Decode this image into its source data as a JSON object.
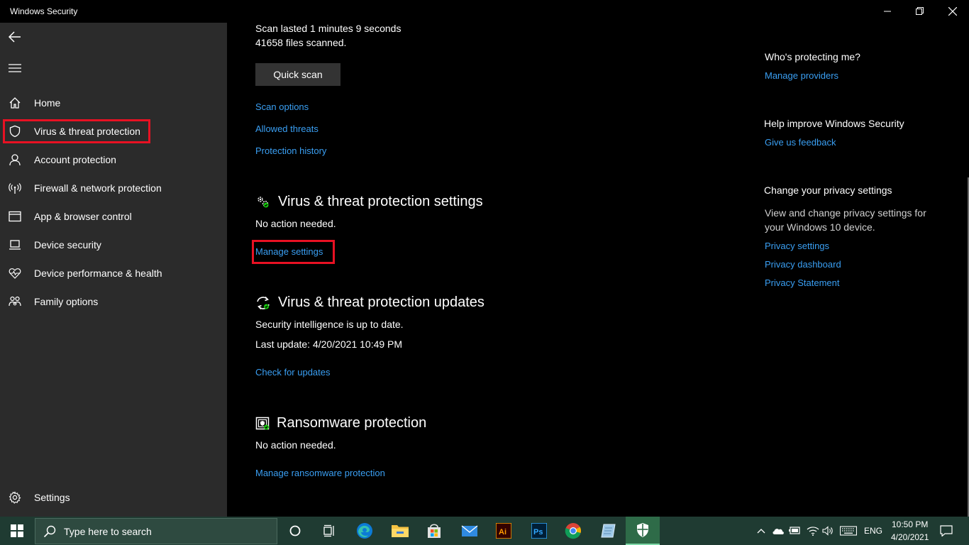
{
  "window": {
    "title": "Windows Security"
  },
  "sidebar": {
    "items": [
      {
        "label": "Home",
        "icon": "home-icon"
      },
      {
        "label": "Virus & threat protection",
        "icon": "shield-icon"
      },
      {
        "label": "Account protection",
        "icon": "person-icon"
      },
      {
        "label": "Firewall & network protection",
        "icon": "wireless-icon"
      },
      {
        "label": "App & browser control",
        "icon": "browser-window-icon"
      },
      {
        "label": "Device security",
        "icon": "laptop-icon"
      },
      {
        "label": "Device performance & health",
        "icon": "heart-pulse-icon"
      },
      {
        "label": "Family options",
        "icon": "family-icon"
      }
    ],
    "settings_label": "Settings"
  },
  "main": {
    "scan_duration": "Scan lasted 1 minutes 9 seconds",
    "files_scanned": "41658 files scanned.",
    "quick_scan_label": "Quick scan",
    "links": {
      "scan_options": "Scan options",
      "allowed_threats": "Allowed threats",
      "protection_history": "Protection history"
    },
    "settings_section": {
      "title": "Virus & threat protection settings",
      "status": "No action needed.",
      "link": "Manage settings"
    },
    "updates_section": {
      "title": "Virus & threat protection updates",
      "status": "Security intelligence is up to date.",
      "last_update": "Last update: 4/20/2021 10:49 PM",
      "link": "Check for updates"
    },
    "ransomware_section": {
      "title": "Ransomware protection",
      "status": "No action needed.",
      "link": "Manage ransomware protection"
    }
  },
  "right_panel": {
    "who_title": "Who's protecting me?",
    "who_link": "Manage providers",
    "help_title": "Help improve Windows Security",
    "help_link": "Give us feedback",
    "privacy_title": "Change your privacy settings",
    "privacy_text": "View and change privacy settings for your Windows 10 device.",
    "privacy_links": [
      "Privacy settings",
      "Privacy dashboard",
      "Privacy Statement"
    ]
  },
  "taskbar": {
    "search_placeholder": "Type here to search",
    "apps": [
      "cortana-icon",
      "task-view-icon",
      "edge-icon",
      "file-explorer-icon",
      "store-icon",
      "mail-icon",
      "illustrator-icon",
      "photoshop-icon",
      "chrome-icon",
      "notepad-icon",
      "windows-security-icon"
    ],
    "language": "ENG",
    "time": "10:50 PM",
    "date": "4/20/2021"
  },
  "colors": {
    "accent_link": "#3a9ff3",
    "highlight": "#e81123",
    "sidebar_bg": "#2b2b2b",
    "taskbar_bg": "#1f3b32"
  }
}
